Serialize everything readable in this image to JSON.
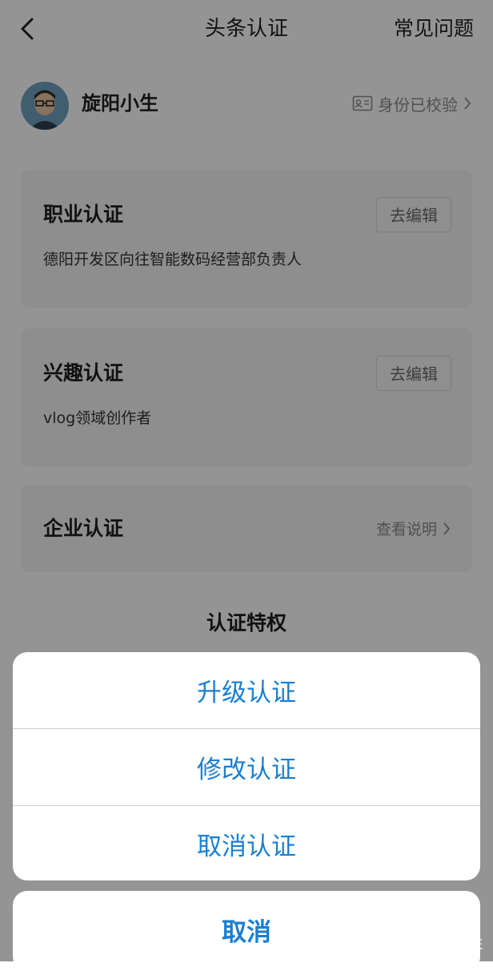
{
  "nav": {
    "title": "头条认证",
    "faq": "常见问题"
  },
  "profile": {
    "name": "旋阳小生",
    "verify_status": "身份已校验"
  },
  "cards": {
    "career": {
      "title": "职业认证",
      "desc": "德阳开发区向往智能数码经营部负责人",
      "edit": "去编辑"
    },
    "interest": {
      "title": "兴趣认证",
      "desc": "vlog领域创作者",
      "edit": "去编辑"
    },
    "enterprise": {
      "title": "企业认证",
      "link": "查看说明"
    }
  },
  "privileges_title": "认证特权",
  "action_sheet": {
    "options": [
      "升级认证",
      "修改认证",
      "取消认证"
    ],
    "cancel": "取消",
    "accent_color": "#1a7fd1"
  },
  "watermark": "头条@旋阳小生"
}
